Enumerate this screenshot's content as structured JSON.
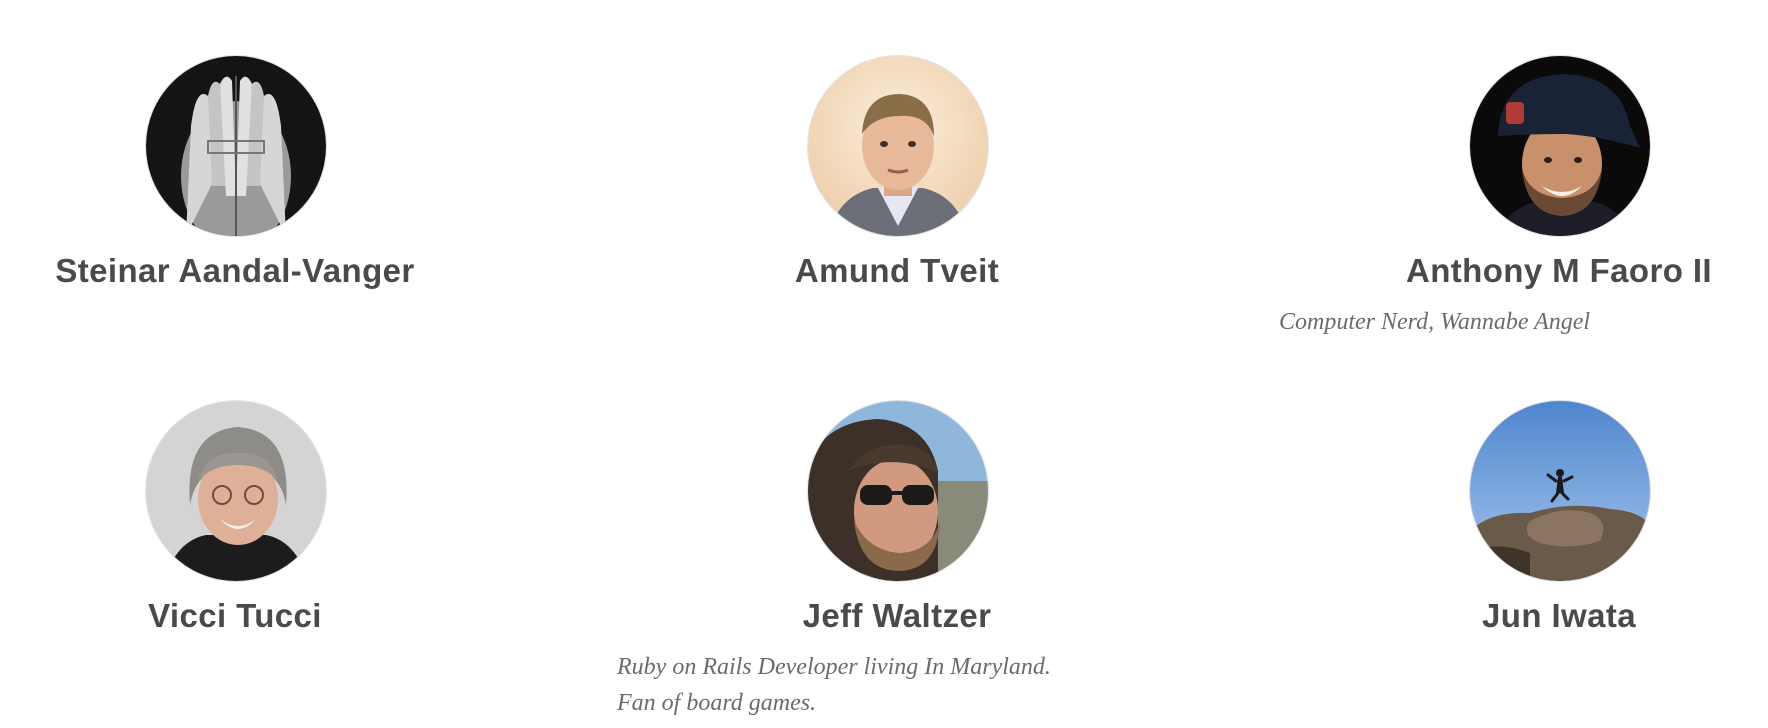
{
  "people": [
    {
      "name": "Steinar Aandal-Vanger",
      "bio": [],
      "avatar_icon": "hands-over-face-photo",
      "avatar_colors": {
        "bg": "#141414",
        "fg": "#cfcfcf"
      }
    },
    {
      "name": "Amund Tveit",
      "bio": [],
      "avatar_icon": "man-portrait-photo",
      "avatar_colors": {
        "bg": "#f2dcc0",
        "fg": "#e3b08e"
      }
    },
    {
      "name": "Anthony M Faoro II",
      "bio": [
        "Computer Nerd, Wannabe Angel"
      ],
      "avatar_icon": "man-with-cap-photo",
      "avatar_colors": {
        "bg": "#0a0a0a",
        "fg": "#c48a66"
      }
    },
    {
      "name": "Vicci Tucci",
      "bio": [],
      "avatar_icon": "woman-portrait-photo",
      "avatar_colors": {
        "bg": "#d4d4d4",
        "fg": "#d7a98f"
      }
    },
    {
      "name": "Jeff Waltzer",
      "bio": [
        "Ruby on Rails Developer living In Maryland.",
        "Fan of board games."
      ],
      "avatar_icon": "man-with-sunglasses-photo",
      "avatar_colors": {
        "bg": "#8fb7dc",
        "fg": "#c9927a"
      }
    },
    {
      "name": "Jun Iwata",
      "bio": [],
      "avatar_icon": "jumper-over-rocks-photo",
      "avatar_colors": {
        "bg": "#6f9fd8",
        "fg": "#6b5a4a"
      }
    }
  ]
}
